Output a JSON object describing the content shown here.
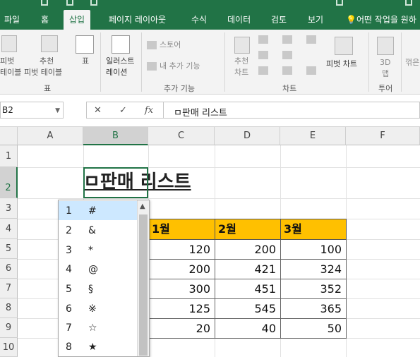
{
  "ribbon_tabs": [
    {
      "label": "파일"
    },
    {
      "label": "홈"
    },
    {
      "label": "삽입"
    },
    {
      "label": "페이지 레이아웃"
    },
    {
      "label": "수식"
    },
    {
      "label": "데이터"
    },
    {
      "label": "검토"
    },
    {
      "label": "보기"
    },
    {
      "label": "어떤 작업을 원하"
    }
  ],
  "ribbon": {
    "pivot_table_line1": "피벗",
    "pivot_table_line2": "테이블",
    "recommended_pivot_line1": "추천",
    "recommended_pivot_line2": "피벗 테이블",
    "table": "표",
    "group_table": "표",
    "illustrations_line1": "일러스트",
    "illustrations_line2": "레이션",
    "store": "스토어",
    "my_addins": "내 추가 기능",
    "group_addins": "추가 기능",
    "recommended_charts_line1": "추천",
    "recommended_charts_line2": "차트",
    "pivot_chart": "피벗 차트",
    "group_charts": "차트",
    "map3d_line1": "3D",
    "map3d_line2": "맵",
    "group_tours": "투어",
    "sparkline": "꺾은"
  },
  "formula_bar": {
    "name_box": "B2",
    "cancel": "✕",
    "enter": "✓",
    "fx": "fx",
    "value": "ㅁ판매 리스트"
  },
  "columns": [
    "A",
    "B",
    "C",
    "D",
    "E",
    "F"
  ],
  "rows": [
    "1",
    "2",
    "3",
    "4",
    "5",
    "6",
    "7",
    "8",
    "9",
    "10"
  ],
  "sheet": {
    "title": "ㅁ판매 리스트",
    "headers": [
      "1월",
      "2월",
      "3월"
    ],
    "data": [
      [
        "120",
        "200",
        "100"
      ],
      [
        "200",
        "421",
        "324"
      ],
      [
        "300",
        "451",
        "352"
      ],
      [
        "125",
        "545",
        "365"
      ],
      [
        "20",
        "40",
        "50"
      ]
    ]
  },
  "symbol_popup": {
    "items": [
      {
        "num": "1",
        "sym": "#"
      },
      {
        "num": "2",
        "sym": "&"
      },
      {
        "num": "3",
        "sym": "*"
      },
      {
        "num": "4",
        "sym": "@"
      },
      {
        "num": "5",
        "sym": "§"
      },
      {
        "num": "6",
        "sym": "※"
      },
      {
        "num": "7",
        "sym": "☆"
      },
      {
        "num": "8",
        "sym": "★"
      }
    ]
  },
  "colors": {
    "excel_green": "#217346",
    "header_fill": "#ffc000",
    "selected_item": "#cde8ff"
  }
}
